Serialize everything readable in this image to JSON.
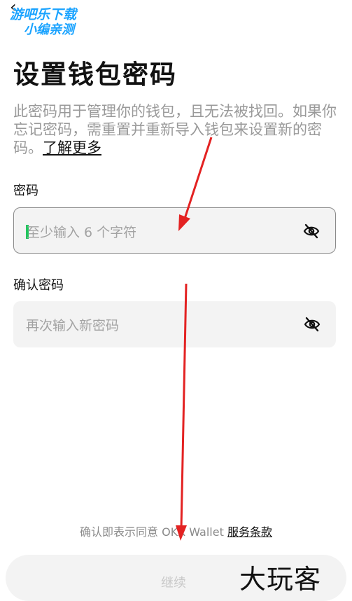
{
  "nav": {
    "back_glyph": "‹",
    "back_icon": "back-arrow-icon"
  },
  "watermark_top": {
    "line1": "游吧乐下载",
    "line2": "小编亲测"
  },
  "page": {
    "title": "设置钱包密码",
    "description": "此密码用于管理你的钱包，且无法被找回。如果你忘记密码，需重置并重新导入钱包来设置新的密码。",
    "learn_more": "了解更多"
  },
  "password": {
    "label": "密码",
    "placeholder": "至少输入 6 个字符",
    "icon": "eye-hidden-icon"
  },
  "confirm": {
    "label": "确认密码",
    "placeholder": "再次输入新密码",
    "icon": "eye-hidden-icon"
  },
  "terms": {
    "prefix": "确认即表示同意 OKX Wallet ",
    "link": "服务条款"
  },
  "continue_button": {
    "label": "继续"
  },
  "watermark_bottom": "大玩客",
  "colors": {
    "annotation_arrow": "#e32222",
    "caret": "#22c55e",
    "watermark_blue": "#1aa3ff"
  }
}
